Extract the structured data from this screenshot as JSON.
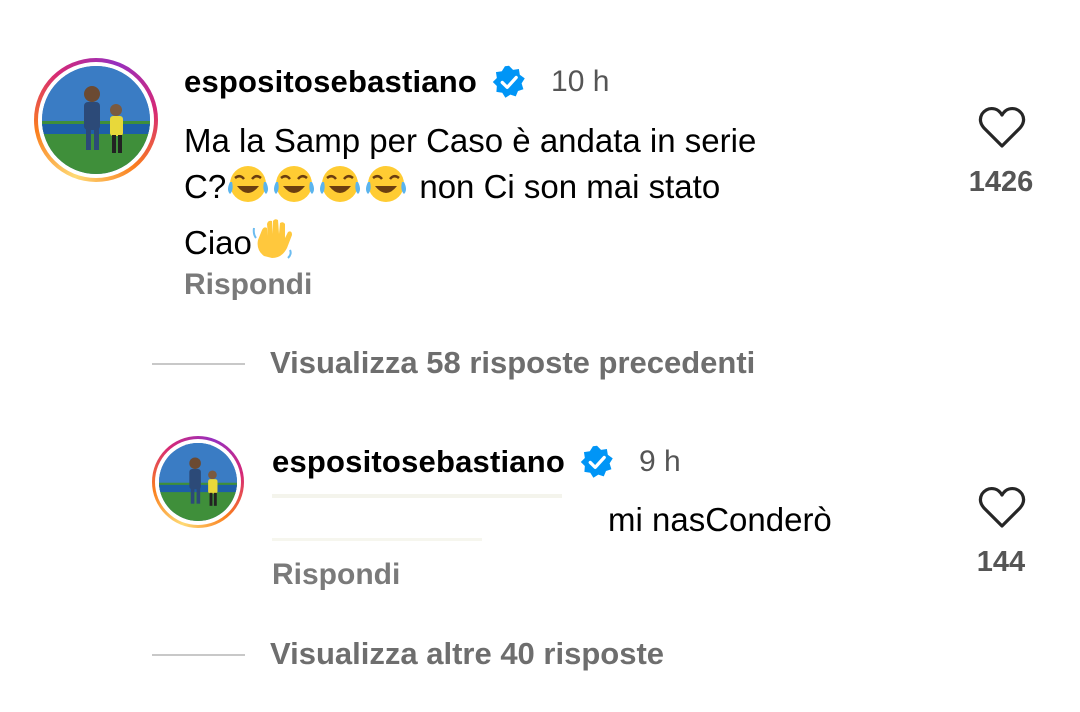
{
  "comment": {
    "username": "espositosebastiano",
    "time": "10 h",
    "text_line1": "Ma la Samp per Caso è andata in serie",
    "text_line2_prefix": "C?",
    "text_line2_suffix": " non Ci son mai stato",
    "text_line3": "Ciao",
    "reply_label": "Rispondi",
    "like_count": "1426",
    "emojis": [
      "face-with-tears-of-joy",
      "face-with-tears-of-joy",
      "face-with-tears-of-joy",
      "face-with-tears-of-joy",
      "waving-hand"
    ]
  },
  "view_previous": "Visualizza 58 risposte precedenti",
  "reply_comment": {
    "username": "espositosebastiano",
    "time": "9 h",
    "text": "mi nasConderò",
    "reply_label": "Rispondi",
    "like_count": "144"
  },
  "view_more": "Visualizza altre 40 risposte",
  "colors": {
    "verified_badge": "#0095f6",
    "secondary_text": "#7a7a7a"
  }
}
